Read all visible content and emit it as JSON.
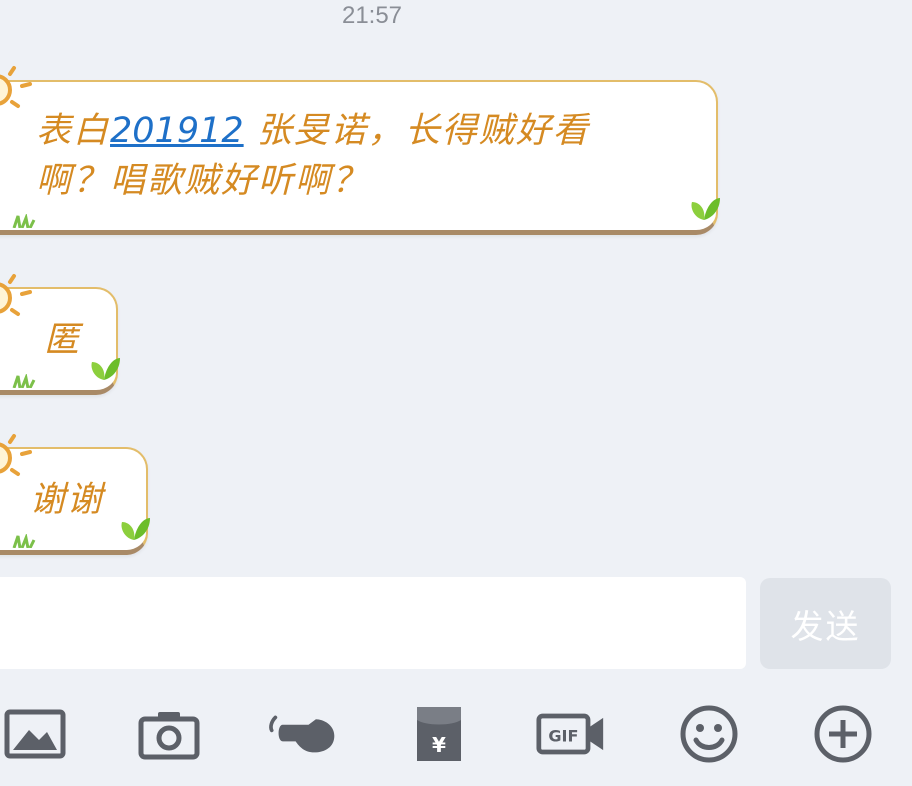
{
  "header": {
    "time": "21:57"
  },
  "messages": [
    {
      "line1_prefix": "表白",
      "link": "201912",
      "line1_suffix": " 张旻诺，长得贼好看",
      "line2": "啊？唱歌贼好听啊？"
    },
    {
      "text": "匿"
    },
    {
      "text": "谢谢"
    }
  ],
  "composer": {
    "input_value": "",
    "send_label": "发送"
  },
  "toolbar": {
    "icons": [
      "image-icon",
      "camera-icon",
      "poke-icon",
      "red-packet-icon",
      "gif-icon",
      "emoji-icon",
      "plus-icon"
    ]
  },
  "colors": {
    "bubble_text": "#d58a22",
    "link": "#1e70c8",
    "bubble_border": "#e3bd6a",
    "icon": "#5c6068",
    "background": "#eef1f6"
  }
}
